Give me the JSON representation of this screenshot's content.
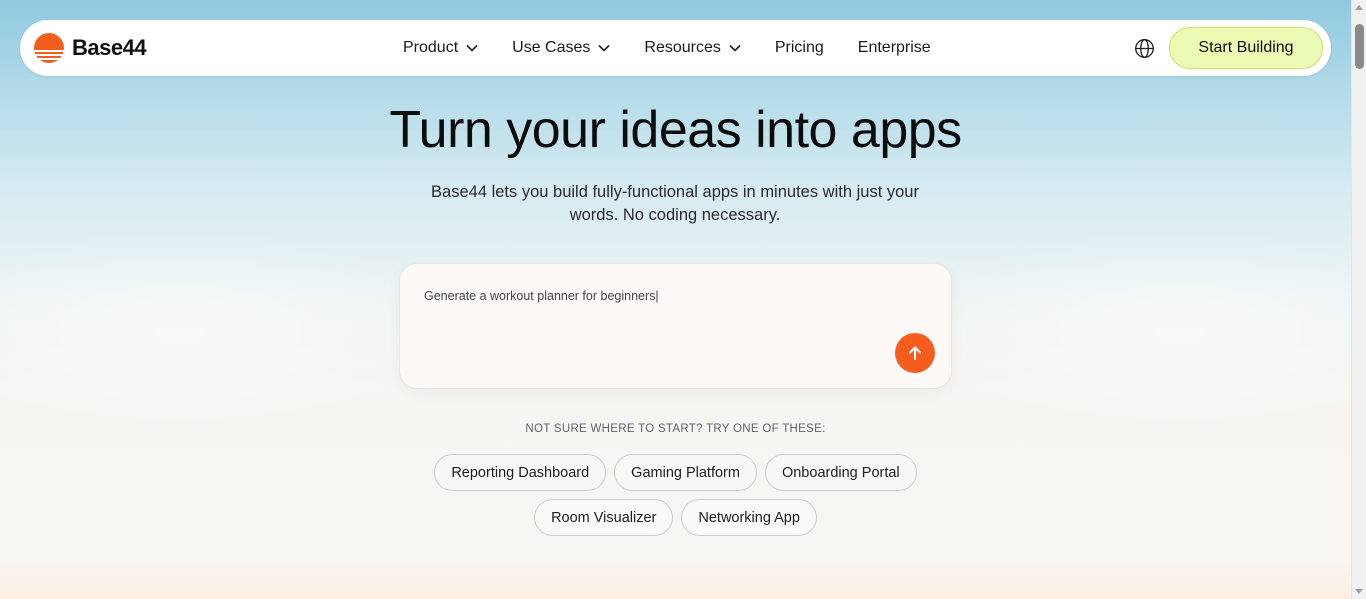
{
  "brand": {
    "name": "Base44",
    "logo_color": "#f25f1c"
  },
  "nav": {
    "items": [
      {
        "label": "Product",
        "has_dropdown": true
      },
      {
        "label": "Use Cases",
        "has_dropdown": true
      },
      {
        "label": "Resources",
        "has_dropdown": true
      },
      {
        "label": "Pricing",
        "has_dropdown": false
      },
      {
        "label": "Enterprise",
        "has_dropdown": false
      }
    ],
    "language_icon": "globe-icon",
    "cta_label": "Start Building",
    "cta_color": "#ecfbb4"
  },
  "hero": {
    "title": "Turn your ideas into apps",
    "subtitle": "Base44 lets you build fully-functional apps in minutes with just your words. No coding necessary."
  },
  "prompt": {
    "value": "Generate a workout planner for beginners|",
    "send_icon": "arrow-up-icon",
    "send_color": "#f55d1f"
  },
  "suggestions": {
    "hint": "NOT SURE WHERE TO START? TRY ONE OF THESE:",
    "row1": [
      "Reporting Dashboard",
      "Gaming Platform",
      "Onboarding Portal"
    ],
    "row2": [
      "Room Visualizer",
      "Networking App"
    ]
  }
}
